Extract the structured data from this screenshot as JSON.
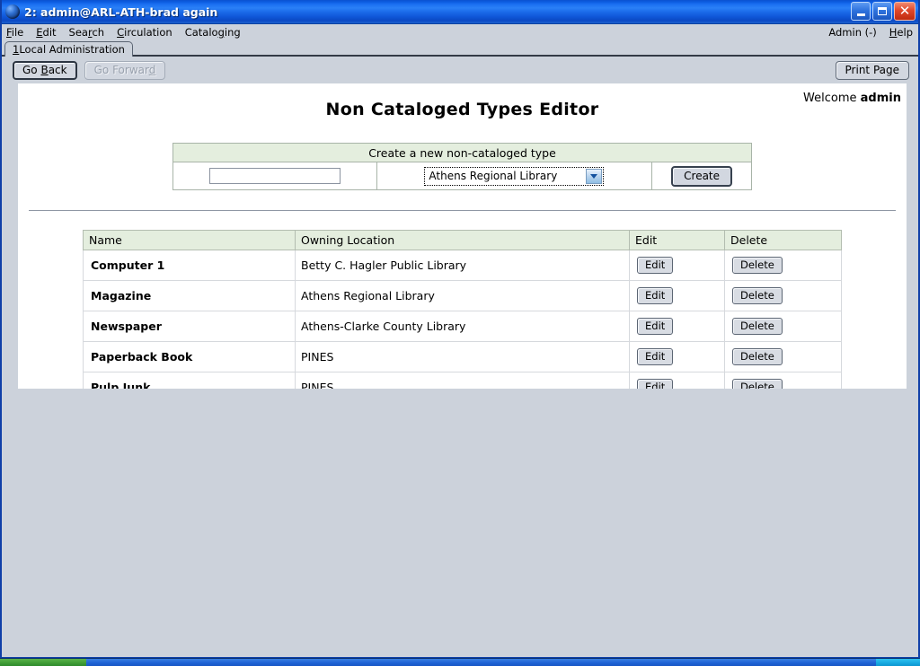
{
  "window": {
    "title": "2: admin@ARL-ATH-brad again",
    "icon": "globe-icon",
    "buttons": {
      "minimize": "minimize-icon",
      "maximize": "restore-icon",
      "close": "close-icon"
    }
  },
  "menubar": {
    "items": [
      {
        "label": "File",
        "accel": "F"
      },
      {
        "label": "Edit",
        "accel": "E"
      },
      {
        "label": "Search",
        "accel": "r"
      },
      {
        "label": "Circulation",
        "accel": "C"
      },
      {
        "label": "Cataloging",
        "accel": "g"
      }
    ],
    "right": [
      {
        "label": "Admin (-)"
      },
      {
        "label": "Help",
        "accel": "H"
      }
    ]
  },
  "tabs": [
    {
      "number": "1",
      "label": " Local Administration",
      "active": true
    }
  ],
  "toolbar": {
    "go_back": "Go Back",
    "go_back_accel": "B",
    "go_forward": "Go Forward",
    "go_forward_disabled": true,
    "print_page": "Print Page"
  },
  "page": {
    "welcome_prefix": "Welcome ",
    "welcome_user": "admin",
    "title": "Non Cataloged Types Editor"
  },
  "create_form": {
    "heading": "Create a new non-cataloged type",
    "name_value": "",
    "name_placeholder": "",
    "owning_location_selected": "Athens Regional Library",
    "owning_location_options": [
      "Athens Regional Library",
      "Athens-Clarke County Library",
      "Betty C. Hagler Public Library",
      "PINES"
    ],
    "create_button": "Create"
  },
  "types_table": {
    "columns": [
      "Name",
      "Owning Location",
      "Edit",
      "Delete"
    ],
    "edit_label": "Edit",
    "delete_label": "Delete",
    "rows": [
      {
        "name": "Computer 1",
        "location": "Betty C. Hagler Public Library"
      },
      {
        "name": "Magazine",
        "location": "Athens Regional Library"
      },
      {
        "name": "Newspaper",
        "location": "Athens-Clarke County Library"
      },
      {
        "name": "Paperback Book",
        "location": "PINES"
      },
      {
        "name": "Pulp Junk",
        "location": "PINES"
      }
    ]
  },
  "taskbar": {
    "start": "start-button",
    "tray": "system-tray"
  },
  "colors": {
    "title_bar_blue": "#0c5ce0",
    "window_chrome": "#ccd2db",
    "table_header_green": "#e4eede",
    "page_white": "#ffffff"
  }
}
